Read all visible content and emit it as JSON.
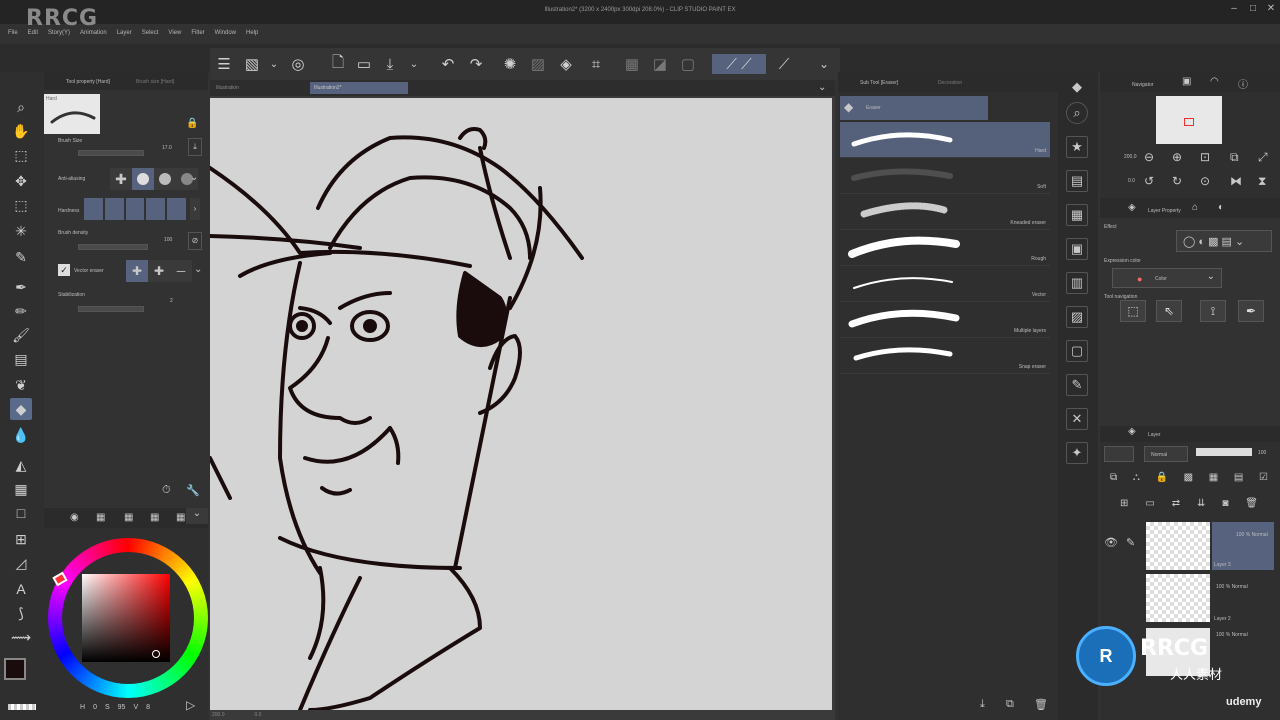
{
  "app": {
    "window_title": "Illustration2* (3200 x 2400px 300dpi 208.0%) - CLIP STUDIO PAINT EX",
    "watermark": "RRCG"
  },
  "menu": [
    "File",
    "Edit",
    "Story(Y)",
    "Animation",
    "Layer",
    "Select",
    "View",
    "Filter",
    "Window",
    "Help"
  ],
  "document_tabs": [
    "Illustration",
    "Illustration2*"
  ],
  "tool_property": {
    "tab_active": "Tool property [Hard]",
    "tab_inactive": "Brush size [Hard]",
    "preset_name": "Hard",
    "brush_size_label": "Brush Size",
    "brush_size_value": "17.0",
    "antialiasing_label": "Anti-aliasing",
    "hardness_label": "Hardness",
    "brush_density_label": "Brush density",
    "brush_density_value": "100",
    "vector_eraser_label": "Vector eraser",
    "stabilization_label": "Stabilization",
    "stabilization_value": "2"
  },
  "color": {
    "main_color": "#1a0c0c",
    "sub_color": "#ffffff",
    "hsv_labels": [
      "H",
      "0",
      "S",
      "95",
      "V",
      "8"
    ]
  },
  "subtool": {
    "tab_active": "Sub Tool [Eraser]",
    "tab_inactive": "Decoration",
    "group_label": "Eraser",
    "brushes": [
      "Hard",
      "Soft",
      "Kneaded eraser",
      "Rough",
      "Vector",
      "Multiple layers",
      "Snap eraser"
    ],
    "selected": "Hard"
  },
  "navigator": {
    "tab_label": "Navigator",
    "zoom_value": "200.0",
    "rotate_value": "0.0"
  },
  "layer_property": {
    "tab_label": "Layer Property",
    "effect_label": "Effect",
    "expression_color_label": "Expression color",
    "expression_color_value": "Color",
    "tool_navigation_label": "Tool navigation"
  },
  "layers": {
    "tab_label": "Layer",
    "blend_mode": "Normal",
    "opacity": "100",
    "items": [
      {
        "opacity_mode": "100 % Normal",
        "name": "Layer 3"
      },
      {
        "opacity_mode": "100 % Normal",
        "name": "Layer 2"
      },
      {
        "opacity_mode": "100 % Normal",
        "name": ""
      }
    ]
  },
  "canvas_status": {
    "zoom": "200.0",
    "angle": "0.0"
  },
  "brand": {
    "badge": "RRCG",
    "badge_sub": "人人素材",
    "provider": "udemy"
  },
  "colors": {
    "accent": "#56627e",
    "canvas": "#d4d4d4",
    "ink": "#1a0c0c"
  }
}
